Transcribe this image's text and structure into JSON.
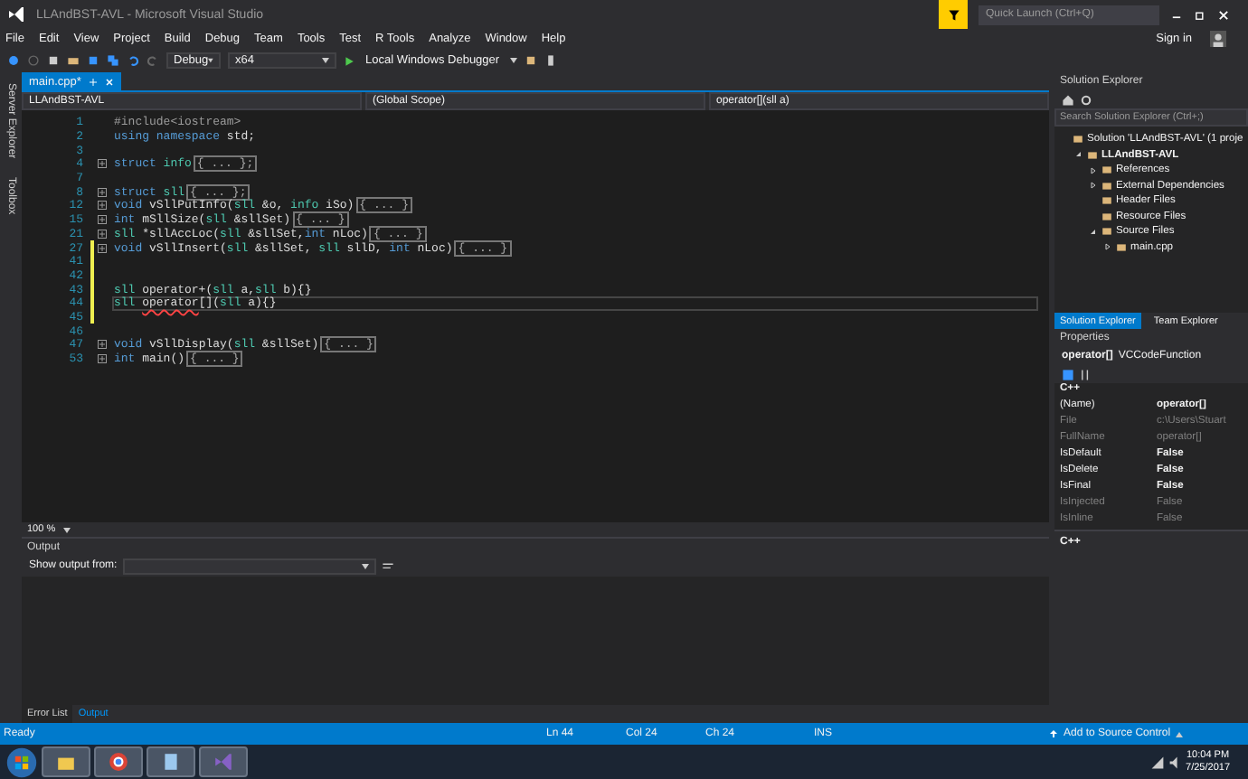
{
  "window": {
    "title": "LLAndBST-AVL - Microsoft Visual Studio",
    "quick_launch_placeholder": "Quick Launch (Ctrl+Q)",
    "sign_in": "Sign in"
  },
  "menu": [
    "File",
    "Edit",
    "View",
    "Project",
    "Build",
    "Debug",
    "Team",
    "Tools",
    "Test",
    "R Tools",
    "Analyze",
    "Window",
    "Help"
  ],
  "toolbar": {
    "configuration": "Debug",
    "platform": "x64",
    "start_button": "Local Windows Debugger"
  },
  "side_tabs": [
    "Server Explorer",
    "Toolbox"
  ],
  "editor": {
    "tabs": [
      {
        "label": "main.cpp*",
        "selected": true
      }
    ],
    "nav": [
      "LLAndBST-AVL",
      "(Global Scope)",
      "operator[](sll a)"
    ],
    "lines": [
      {
        "number": "1",
        "segments": [
          {
            "text": "#include<iostream>",
            "kind": "preproc"
          }
        ],
        "fold": false,
        "modified": false,
        "current": false
      },
      {
        "number": "2",
        "segments": [
          {
            "text": "using namespace",
            "kind": "keyword"
          },
          {
            "text": " std;",
            "kind": "plain"
          }
        ],
        "fold": false,
        "modified": false,
        "current": false
      },
      {
        "number": "3",
        "fold": false,
        "modified": false,
        "current": false
      },
      {
        "number": "4",
        "segments": [
          {
            "text": "struct",
            "kind": "keyword"
          },
          {
            "text": " info",
            "kind": "type"
          }
        ],
        "folded": "{ ... };",
        "fold": true,
        "modified": false,
        "current": false
      },
      {
        "number": "7",
        "fold": false,
        "modified": false,
        "current": false
      },
      {
        "number": "8",
        "segments": [
          {
            "text": "struct",
            "kind": "keyword"
          },
          {
            "text": " sll",
            "kind": "type"
          }
        ],
        "folded": "{ ... };",
        "fold": true,
        "modified": false,
        "current": false
      },
      {
        "number": "12",
        "segments": [
          {
            "text": "void",
            "kind": "keyword"
          },
          {
            "text": " vSllPutInfo(",
            "kind": "plain"
          },
          {
            "text": "sll",
            "kind": "type"
          },
          {
            "text": " &o, ",
            "kind": "plain"
          },
          {
            "text": "info",
            "kind": "type"
          },
          {
            "text": " iSo)",
            "kind": "plain"
          }
        ],
        "folded": "{ ... }",
        "fold": true,
        "modified": false,
        "current": false
      },
      {
        "number": "15",
        "segments": [
          {
            "text": "int",
            "kind": "keyword"
          },
          {
            "text": " mSllSize(",
            "kind": "plain"
          },
          {
            "text": "sll",
            "kind": "type"
          },
          {
            "text": " &sllSet)",
            "kind": "plain"
          }
        ],
        "folded": "{ ... }",
        "fold": true,
        "modified": false,
        "current": false
      },
      {
        "number": "21",
        "segments": [
          {
            "text": "sll",
            "kind": "type"
          },
          {
            "text": " *sllAccLoc(",
            "kind": "plain"
          },
          {
            "text": "sll",
            "kind": "type"
          },
          {
            "text": " &sllSet,",
            "kind": "plain"
          },
          {
            "text": "int",
            "kind": "keyword"
          },
          {
            "text": " nLoc)",
            "kind": "plain"
          }
        ],
        "folded": "{ ... }",
        "fold": true,
        "modified": false,
        "current": false
      },
      {
        "number": "27",
        "segments": [
          {
            "text": "void",
            "kind": "keyword"
          },
          {
            "text": " vSllInsert(",
            "kind": "plain"
          },
          {
            "text": "sll",
            "kind": "type"
          },
          {
            "text": " &sllSet, ",
            "kind": "plain"
          },
          {
            "text": "sll",
            "kind": "type"
          },
          {
            "text": " sllD, ",
            "kind": "plain"
          },
          {
            "text": "int",
            "kind": "keyword"
          },
          {
            "text": " nLoc)",
            "kind": "plain"
          }
        ],
        "folded": "{ ... }",
        "fold": true,
        "modified": true,
        "current": false
      },
      {
        "number": "41",
        "fold": false,
        "modified": true,
        "current": false
      },
      {
        "number": "42",
        "fold": false,
        "modified": true,
        "current": false
      },
      {
        "number": "43",
        "segments": [
          {
            "text": "sll",
            "kind": "type"
          },
          {
            "text": " operator+(",
            "kind": "plain"
          },
          {
            "text": "sll",
            "kind": "type"
          },
          {
            "text": " a,",
            "kind": "plain"
          },
          {
            "text": "sll",
            "kind": "type"
          },
          {
            "text": " b){}",
            "kind": "plain"
          }
        ],
        "fold": false,
        "modified": true,
        "current": false
      },
      {
        "number": "44",
        "segments": [
          {
            "text": "sll ",
            "kind": "type"
          },
          {
            "text": "operator",
            "kind": "error"
          },
          {
            "text": "[](",
            "kind": "plain"
          },
          {
            "text": "sll",
            "kind": "type"
          },
          {
            "text": " a){}",
            "kind": "plain"
          }
        ],
        "fold": false,
        "modified": true,
        "current": true
      },
      {
        "number": "45",
        "fold": false,
        "modified": true,
        "current": false
      },
      {
        "number": "46",
        "fold": false,
        "modified": false,
        "current": false
      },
      {
        "number": "47",
        "segments": [
          {
            "text": "void",
            "kind": "keyword"
          },
          {
            "text": " vSllDisplay(",
            "kind": "plain"
          },
          {
            "text": "sll",
            "kind": "type"
          },
          {
            "text": " &sllSet)",
            "kind": "plain"
          }
        ],
        "folded": "{ ... }",
        "fold": true,
        "modified": false,
        "current": false
      },
      {
        "number": "53",
        "segments": [
          {
            "text": "int",
            "kind": "keyword"
          },
          {
            "text": " main()",
            "kind": "plain"
          }
        ],
        "folded": "{ ... }",
        "fold": true,
        "modified": false,
        "current": false
      }
    ],
    "zoom": "100 %"
  },
  "output": {
    "title": "Output",
    "show_from": "Show output from:",
    "tabs": [
      {
        "label": "Error List",
        "selected": false
      },
      {
        "label": "Output",
        "selected": true
      }
    ]
  },
  "solution_explorer": {
    "title": "Solution Explorer",
    "search_placeholder": "Search Solution Explorer (Ctrl+;)",
    "tree": [
      {
        "label": "Solution 'LLAndBST-AVL' (1 proje",
        "bold": false,
        "children": [
          {
            "label": "LLAndBST-AVL",
            "expanded": true,
            "bold": true,
            "children": [
              {
                "label": "References",
                "expanded": false,
                "bold": false
              },
              {
                "label": "External Dependencies",
                "expanded": false,
                "bold": false
              },
              {
                "label": "Header Files",
                "bold": false
              },
              {
                "label": "Resource Files",
                "bold": false
              },
              {
                "label": "Source Files",
                "expanded": true,
                "bold": false,
                "children": [
                  {
                    "label": "main.cpp",
                    "expanded": false,
                    "bold": false
                  }
                ]
              }
            ]
          }
        ]
      }
    ],
    "tabs": [
      {
        "label": "Solution Explorer",
        "selected": true
      },
      {
        "label": "Team Explorer",
        "selected": false
      }
    ]
  },
  "properties": {
    "title": "Properties",
    "object_name": "operator[]",
    "object_type": "VCCodeFunction",
    "category": "C++",
    "rows": [
      {
        "name": "(Name)",
        "value": "operator[]",
        "readonly": false
      },
      {
        "name": "File",
        "value": "c:\\Users\\Stuart",
        "readonly": true
      },
      {
        "name": "FullName",
        "value": "operator[]",
        "readonly": true
      },
      {
        "name": "IsDefault",
        "value": "False",
        "readonly": false
      },
      {
        "name": "IsDelete",
        "value": "False",
        "readonly": false
      },
      {
        "name": "IsFinal",
        "value": "False",
        "readonly": false
      },
      {
        "name": "IsInjected",
        "value": "False",
        "readonly": true
      },
      {
        "name": "IsInline",
        "value": "False",
        "readonly": true
      }
    ],
    "description": "C++"
  },
  "status_bar": {
    "state": "Ready",
    "line": "Ln 44",
    "col": "Col 24",
    "ch": "Ch 24",
    "mode": "INS",
    "source_control": "Add to Source Control"
  },
  "taskbar": {
    "time": "10:04 PM",
    "date": "7/25/2017"
  }
}
